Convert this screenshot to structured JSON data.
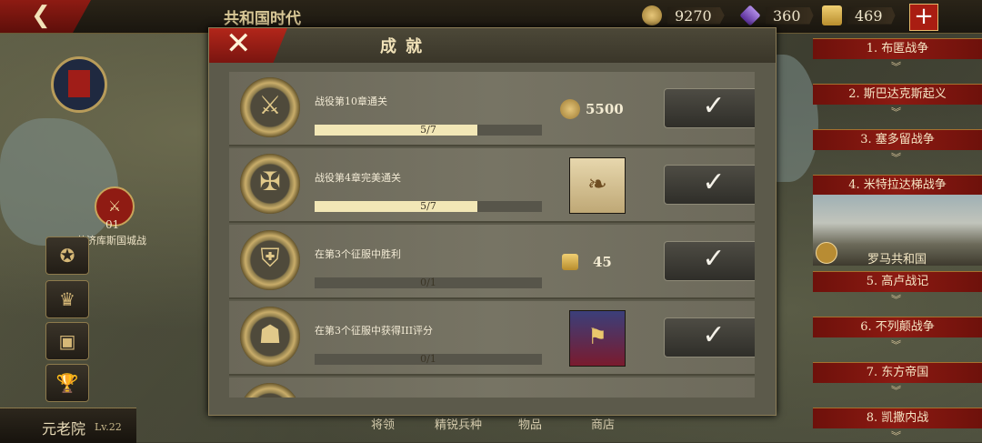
{
  "topbar": {
    "back_icon": "back-arrow-icon",
    "era_title": "共和国时代",
    "resources": [
      {
        "icon": "gold-coin-icon",
        "value": "9270",
        "color": "#c9a14a"
      },
      {
        "icon": "purple-gem-icon",
        "value": "360",
        "color": "#8a55c8"
      },
      {
        "icon": "laurel-token-icon",
        "value": "469",
        "color": "#d7a94a"
      }
    ],
    "plus_label": "+"
  },
  "left": {
    "battle_number": "01",
    "battle_name": "共济库斯国城战",
    "senate_label": "元老院",
    "senate_level": "Lv.22"
  },
  "bottom_tabs": [
    "将领",
    "精锐兵种",
    "物品",
    "商店"
  ],
  "dialog": {
    "title": "成就",
    "close_label": "✕",
    "achievements": [
      {
        "icon": "crossed-swords-medal-icon",
        "description": "战役第10章通关",
        "progress_text": "5/7",
        "progress": 0.714,
        "reward_type": "coin",
        "reward_value": "5500",
        "claim_label": "✓"
      },
      {
        "icon": "eagle-swords-medal-icon",
        "description": "战役第4章完美通关",
        "progress_text": "5/7",
        "progress": 0.714,
        "reward_type": "scroll",
        "reward_value": "",
        "claim_label": "✓"
      },
      {
        "icon": "shield-spear-medal-icon",
        "description": "在第3个征服中胜利",
        "progress_text": "0/1",
        "progress": 0,
        "reward_type": "token",
        "reward_value": "45",
        "claim_label": "✓"
      },
      {
        "icon": "legion-shield-medal-icon",
        "description": "在第3个征服中获得III评分",
        "progress_text": "0/1",
        "progress": 0,
        "reward_type": "flag",
        "reward_value": "",
        "claim_label": "✓"
      }
    ]
  },
  "chapters": [
    {
      "label": "1. 布匿战争"
    },
    {
      "label": "2. 斯巴达克斯起义"
    },
    {
      "label": "3. 塞多留战争"
    },
    {
      "label": "4. 米特拉达梯战争"
    },
    {
      "label": "5. 高卢战记"
    },
    {
      "label": "6. 不列颠战争"
    },
    {
      "label": "7. 东方帝国"
    },
    {
      "label": "8. 凯撒内战"
    }
  ],
  "chapter_image_label": "罗马共和国"
}
